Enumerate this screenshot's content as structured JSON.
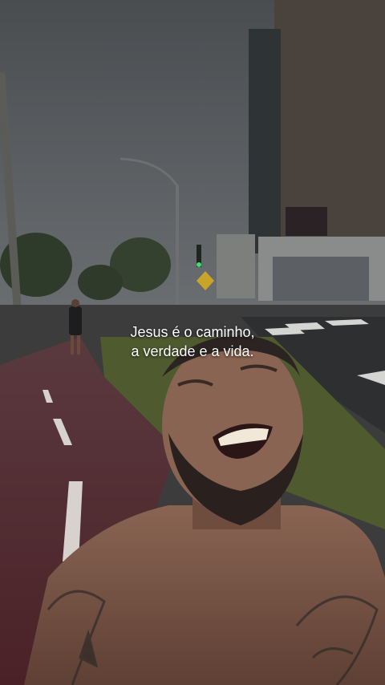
{
  "caption": {
    "line1": "Jesus é o caminho,",
    "line2": "a verdade e a vida."
  },
  "colors": {
    "sky": "#55595c",
    "bike_lane": "#5a2f35",
    "grass": "#4f5a2f",
    "skin": "#7e5a48",
    "building": "#47403a"
  }
}
